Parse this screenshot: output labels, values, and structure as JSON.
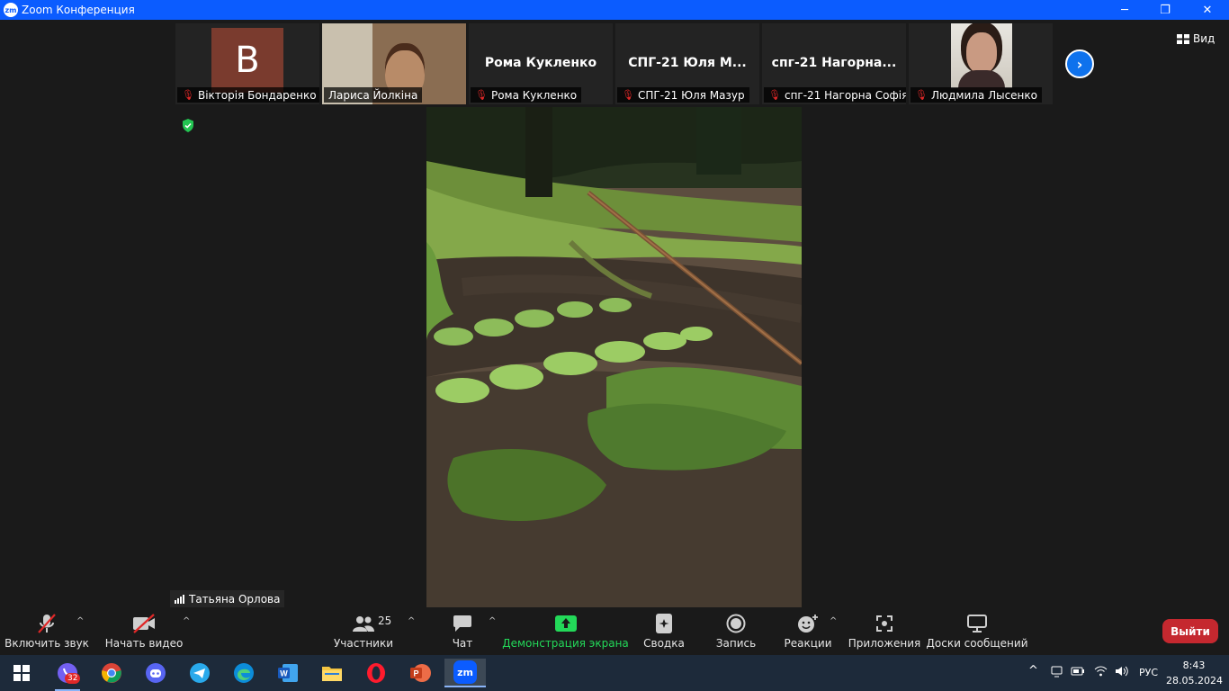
{
  "window": {
    "app_icon": "zm",
    "title": "Zoom Конференция",
    "minimize": "─",
    "restore": "❐",
    "close": "✕"
  },
  "participants": [
    {
      "label": "Вікторія Бондаренко",
      "avatar_letter": "B",
      "muted": true
    },
    {
      "label": "Лариса Йолкіна",
      "muted": false
    },
    {
      "big_name": "Рома Кукленко",
      "label": "Рома Кукленко",
      "muted": true
    },
    {
      "big_name": "СПГ-21  Юля  М...",
      "label": "СПГ-21 Юля Мазур",
      "muted": true
    },
    {
      "big_name": "спг-21  Нагорна...",
      "label": "спг-21 Нагорна Софія",
      "muted": true
    },
    {
      "label": "Людмила Лысенко",
      "muted": true
    }
  ],
  "view_label": "Вид",
  "speaker_label": "Татьяна Орлова",
  "toolbar": {
    "unmute": "Включить звук",
    "start_video": "Начать видео",
    "participants": "Участники",
    "participants_count": "25",
    "chat": "Чат",
    "share_screen": "Демонстрация экрана",
    "summary": "Сводка",
    "record": "Запись",
    "reactions": "Реакции",
    "apps": "Приложения",
    "whiteboards": "Доски сообщений",
    "leave": "Выйти"
  },
  "taskbar": {
    "viber_badge": "32",
    "zoom_label": "zm",
    "language": "РУС",
    "time": "8:43",
    "date": "28.05.2024"
  },
  "colors": {
    "title_bar": "#0b5cff",
    "leave": "#c5282f",
    "share_green": "#23d959",
    "accent_blue": "#0e72ed"
  }
}
